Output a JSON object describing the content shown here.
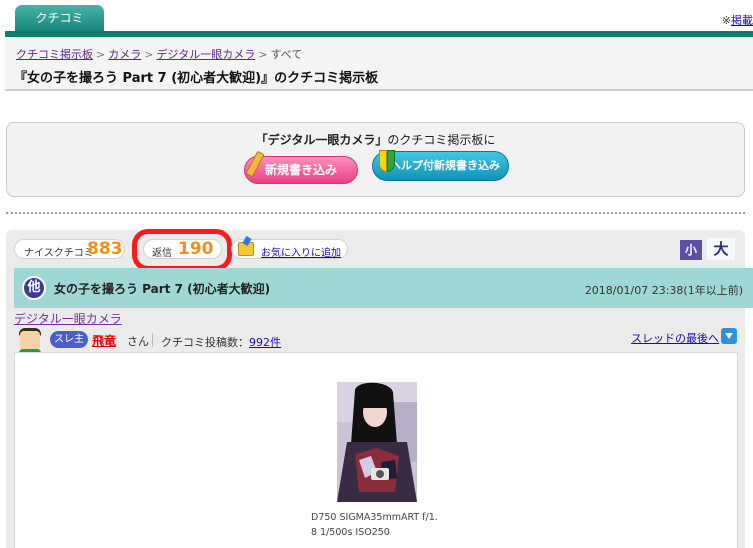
{
  "tab": {
    "label": "クチコミ"
  },
  "topnote": {
    "mark": "※",
    "link": "掲載"
  },
  "breadcrumb": {
    "items": [
      "クチコミ掲示板",
      "カメラ",
      "デジタル一眼カメラ"
    ],
    "current": "すべて",
    "separator": ">"
  },
  "page_title": "『女の子を撮ろう Part 7 (初心者大歓迎)』のクチコミ掲示板",
  "post_box": {
    "text_category": "「デジタル一眼カメラ」",
    "text_suffix": "のクチコミ掲示板に",
    "new_post_button": "新規書き込み",
    "help_post_button": "ヘルプ付新規書き込み"
  },
  "stats": {
    "nice_label": "ナイスクチコミ",
    "nice_count": "883",
    "reply_label": "返信",
    "reply_count": "190",
    "favorite_label": "お気に入りに追加"
  },
  "text_size": {
    "small": "小",
    "large": "大"
  },
  "thread": {
    "category_badge": "他",
    "title": "女の子を撮ろう Part 7 (初心者大歓迎)",
    "date": "2018/01/07 23:38(1年以上前)",
    "category_link": "デジタル一眼カメラ",
    "owner_badge": "スレ主",
    "username": "飛竜",
    "username_suffix": "さん",
    "post_count_label": "クチコミ投稿数：",
    "post_count": "992件",
    "to_last": "スレッドの最後へ",
    "photo_caption_line1": "D750 SIGMA35mmART f/1.",
    "photo_caption_line2": "8 1/500s ISO250"
  },
  "colors": {
    "brand_teal": "#0f7e72",
    "accent_orange": "#f0901a",
    "highlight_red": "#ff1a1a",
    "thread_header": "#9fd7d4"
  }
}
